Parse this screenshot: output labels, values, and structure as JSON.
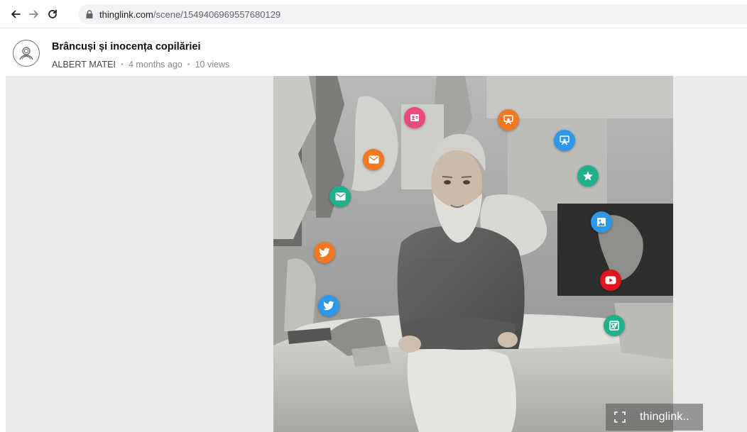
{
  "browser": {
    "url_host": "thinglink.com",
    "url_path": "/scene/1549406969557680129"
  },
  "header": {
    "title": "Brâncuși și inocența copilăriei",
    "author": "ALBERT MATEI",
    "time": "4 months ago",
    "views": "10 views",
    "separator": "•"
  },
  "hotspots": [
    {
      "icon": "contact-card-icon",
      "color": "#e84d7a"
    },
    {
      "icon": "teacher-icon",
      "color": "#f07820"
    },
    {
      "icon": "teacher-icon",
      "color": "#2f97e8"
    },
    {
      "icon": "mail-icon",
      "color": "#f07820"
    },
    {
      "icon": "star-icon",
      "color": "#22b08a"
    },
    {
      "icon": "mail-icon",
      "color": "#22b08a"
    },
    {
      "icon": "image-icon",
      "color": "#2f97e8"
    },
    {
      "icon": "twitter-icon",
      "color": "#f07820"
    },
    {
      "icon": "youtube-icon",
      "color": "#e0141e"
    },
    {
      "icon": "twitter-icon",
      "color": "#2f97e8"
    },
    {
      "icon": "map-icon",
      "color": "#22b08a"
    }
  ],
  "branding": {
    "logo_text": "thinglink.."
  }
}
